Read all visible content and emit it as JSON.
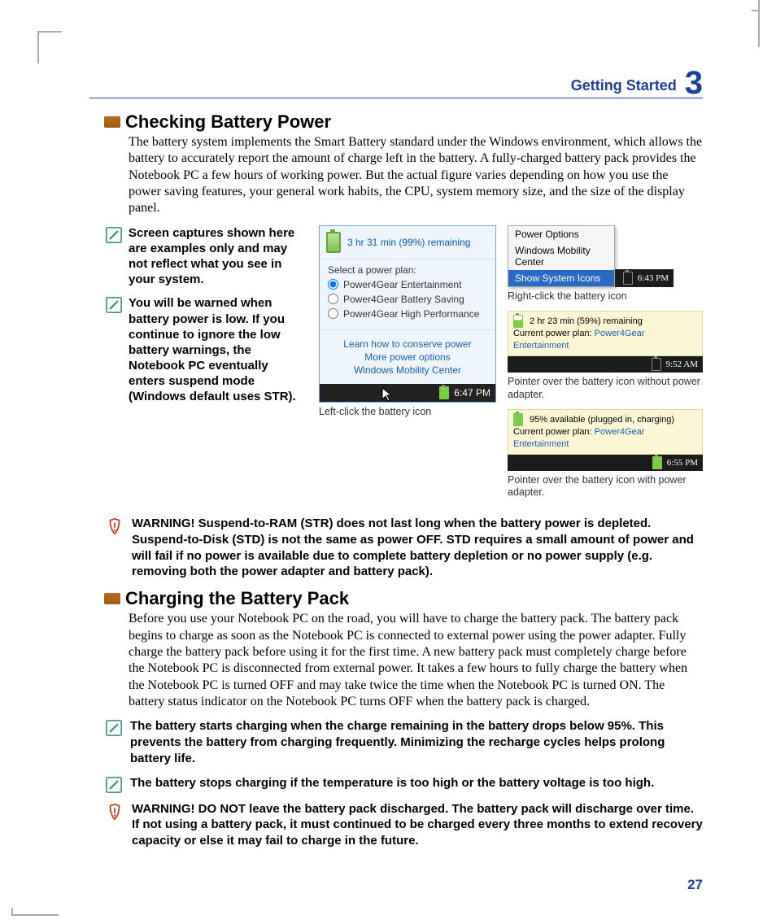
{
  "header": {
    "title": "Getting Started",
    "chapter": "3"
  },
  "page_number": "27",
  "sect1": {
    "title": "Checking Battery Power",
    "body": "The battery system implements the Smart Battery standard under the Windows environment, which allows the battery to accurately report the amount of charge left in the battery. A fully-charged battery pack provides the Notebook PC a few hours of working power. But the actual figure varies depending on how you use the power saving features, your general work habits, the CPU, system memory size, and the size of the display panel."
  },
  "note1": "Screen captures shown here are examples only and may not reflect what you see in your system.",
  "note2": "You will be warned when battery power is low. If you continue to ignore the low battery warnings, the Notebook PC eventually enters suspend mode (Windows default uses STR).",
  "leftclick": {
    "batt_status": "3 hr 31 min (99%) remaining",
    "plan_label": "Select a power plan:",
    "opt1": "Power4Gear Entertainment",
    "opt2": "Power4Gear Battery Saving",
    "opt3": "Power4Gear High Performance",
    "link1": "Learn how to conserve power",
    "link2": "More power options",
    "link3": "Windows Mobility Center",
    "time": "6:47 PM",
    "caption": "Left-click the battery icon"
  },
  "rightclick": {
    "m1": "Power Options",
    "m2": "Windows Mobility Center",
    "m3": "Show System Icons",
    "time": "6:43 PM",
    "caption": "Right-click the battery icon"
  },
  "hover1": {
    "status": "2 hr 23 min (59%) remaining",
    "plan_prefix": "Current power plan:",
    "plan": "Power4Gear Entertainment",
    "time": "9:52 AM",
    "caption": "Pointer over the battery icon without power adapter."
  },
  "hover2": {
    "status": "95% available (plugged in, charging)",
    "plan_prefix": "Current power plan:",
    "plan": "Power4Gear Entertainment",
    "time": "6:55 PM",
    "caption": "Pointer over the battery icon with power adapter."
  },
  "warn1": "WARNING!  Suspend-to-RAM (STR) does not last long when the battery power is depleted. Suspend-to-Disk (STD) is not the same as power OFF. STD requires a small amount of power and will fail if no power is available due to complete battery depletion or no power supply (e.g. removing both the power adapter and battery pack).",
  "sect2": {
    "title": "Charging the Battery Pack",
    "body": "Before you use your Notebook PC on the road, you will have to charge the battery pack. The battery pack begins to charge as soon as the Notebook PC is connected to external power using the power adapter. Fully charge the battery pack before using it for the first time. A new battery pack must completely charge before the Notebook PC is disconnected from external power. It takes a few hours to fully charge the battery when the Notebook PC is turned OFF and may take twice the time when the Notebook PC is turned ON. The battery status indicator on the Notebook PC turns OFF when the battery pack is charged."
  },
  "note3": "The battery starts charging when the charge remaining in the battery drops below 95%. This prevents the battery from charging frequently. Minimizing the recharge cycles helps prolong battery life.",
  "note4": "The battery stops charging if the temperature is too high or the battery voltage is too high.",
  "warn2": "WARNING!  DO NOT leave the battery pack discharged. The battery pack will discharge over time. If not using a battery pack, it must continued to be charged every three months to extend recovery capacity or else it may fail to charge in the future."
}
